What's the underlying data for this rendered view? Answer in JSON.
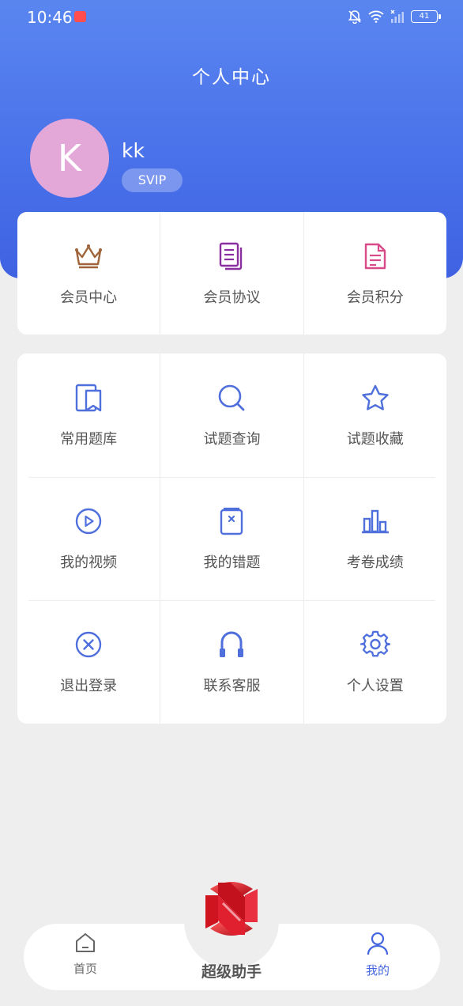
{
  "status_bar": {
    "time": "10:46",
    "battery": "41"
  },
  "header": {
    "title": "个人中心"
  },
  "profile": {
    "avatar_letter": "K",
    "username": "kk",
    "badge": "SVIP"
  },
  "top_menu": [
    {
      "label": "会员中心",
      "icon": "crown-icon",
      "color": "#a0643a"
    },
    {
      "label": "会员协议",
      "icon": "documents-icon",
      "color": "#8a2fa0"
    },
    {
      "label": "会员积分",
      "icon": "document-icon",
      "color": "#d94a88"
    }
  ],
  "grid_menu": [
    {
      "label": "常用题库",
      "icon": "bookmark-book-icon"
    },
    {
      "label": "试题查询",
      "icon": "search-icon"
    },
    {
      "label": "试题收藏",
      "icon": "star-icon"
    },
    {
      "label": "我的视频",
      "icon": "play-circle-icon"
    },
    {
      "label": "我的错题",
      "icon": "wrong-book-icon"
    },
    {
      "label": "考卷成绩",
      "icon": "bar-chart-icon"
    },
    {
      "label": "退出登录",
      "icon": "close-circle-icon"
    },
    {
      "label": "联系客服",
      "icon": "headset-icon"
    },
    {
      "label": "个人设置",
      "icon": "gear-icon"
    }
  ],
  "tabbar": {
    "home_label": "首页",
    "center_label": "超级助手",
    "me_label": "我的"
  },
  "colors": {
    "accent": "#4a6de5",
    "grid_icon": "#4f6fdc",
    "header_top": "#5a86f0",
    "header_bottom": "#3f62e2",
    "avatar_bg": "#e4a8d8",
    "logo_red": "#e0202e"
  }
}
